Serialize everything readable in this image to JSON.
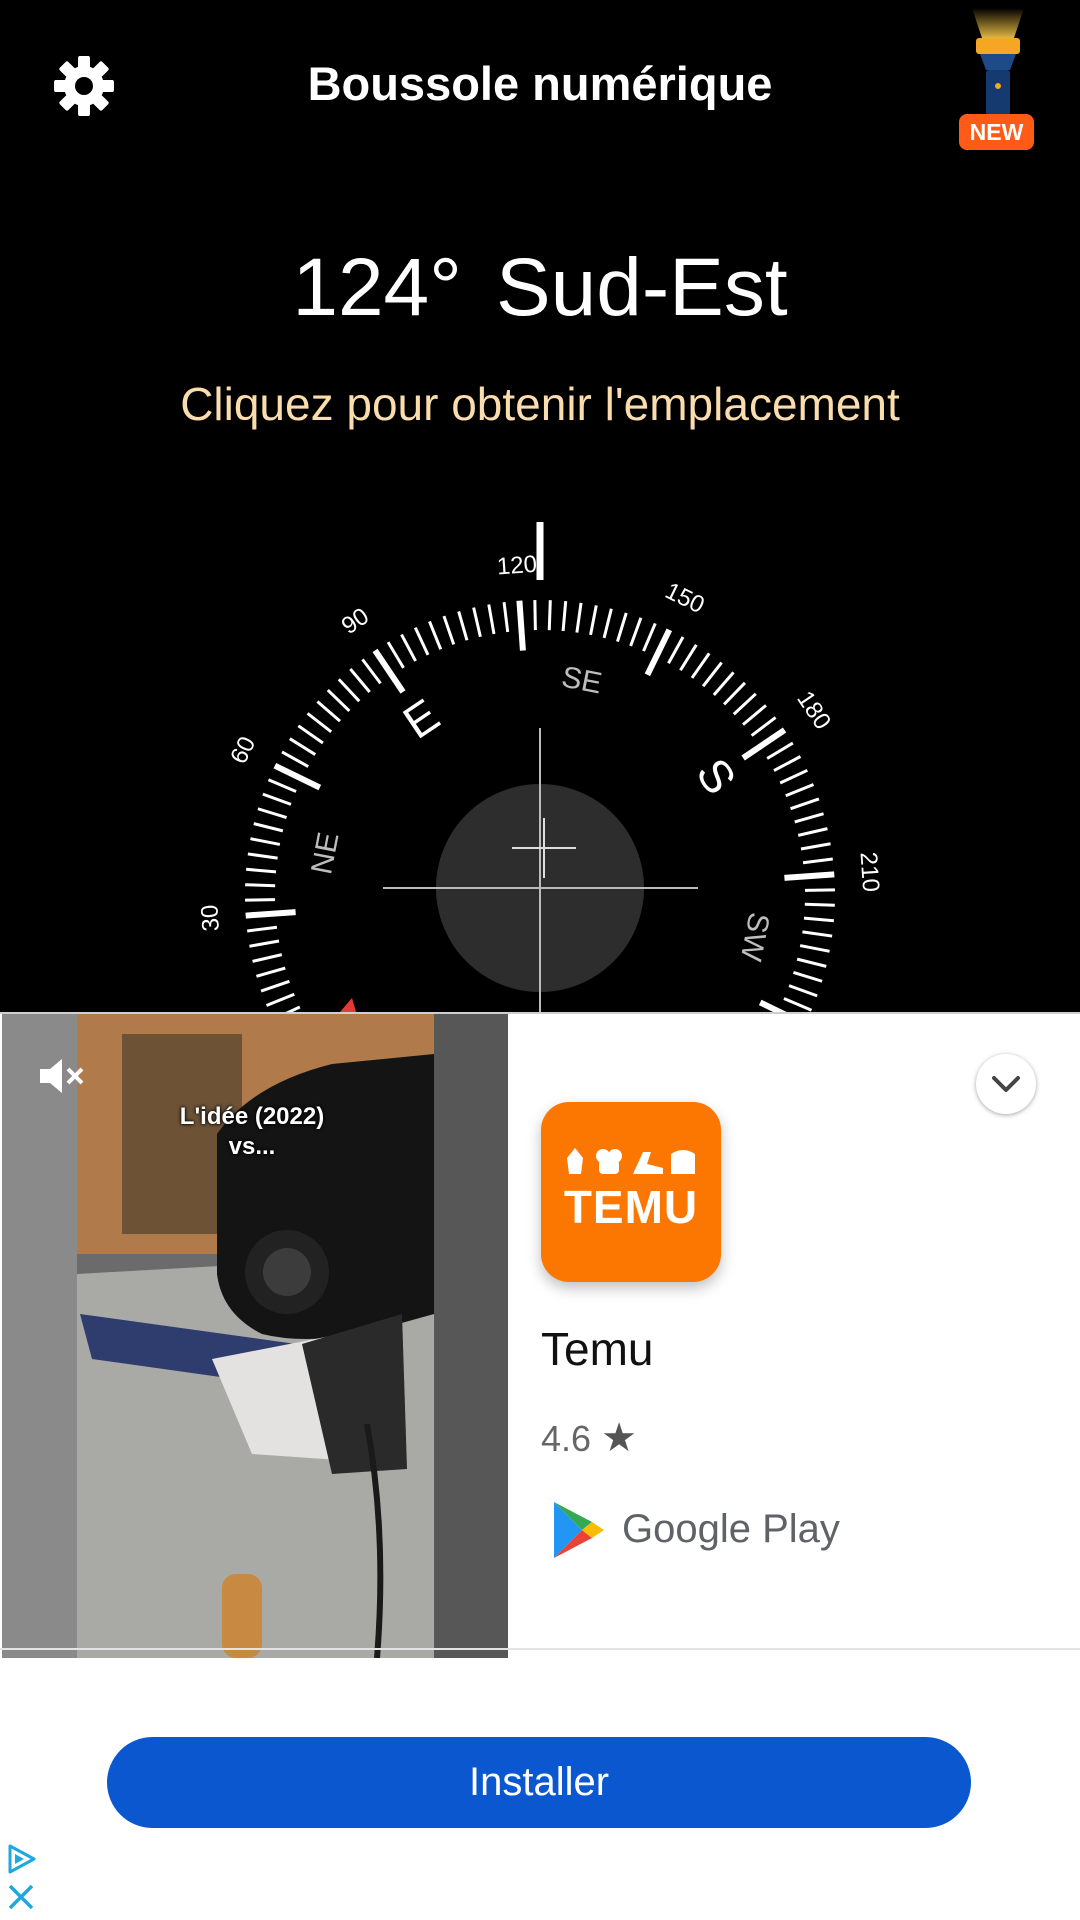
{
  "header": {
    "title": "Boussole numérique",
    "settings_icon": "gear-icon",
    "flashlight_icon": "flashlight-icon",
    "new_badge": "NEW"
  },
  "heading": {
    "degrees": "124°",
    "direction": "Sud-Est",
    "location_prompt": "Cliquez pour obtenir l'emplacement"
  },
  "compass": {
    "heading_deg": 124,
    "degree_labels": [
      "30",
      "60",
      "90",
      "120",
      "150",
      "180",
      "210"
    ],
    "cardinal_labels": [
      "E",
      "S"
    ],
    "intercardinal_labels": [
      "NE",
      "SE",
      "SW"
    ]
  },
  "ad": {
    "video": {
      "caption_line1": "L'idée (2022)",
      "caption_line2": "vs...",
      "mute_icon": "muted-speaker-icon"
    },
    "app_icon_text": "TEMU",
    "app_name": "Temu",
    "rating": "4.6",
    "store_label": "Google Play",
    "install_label": "Installer",
    "colors": {
      "accent_orange": "#fb7701",
      "install_blue": "#0b57d0",
      "location_text": "#fbdcad",
      "new_badge": "#ff5a16"
    }
  }
}
